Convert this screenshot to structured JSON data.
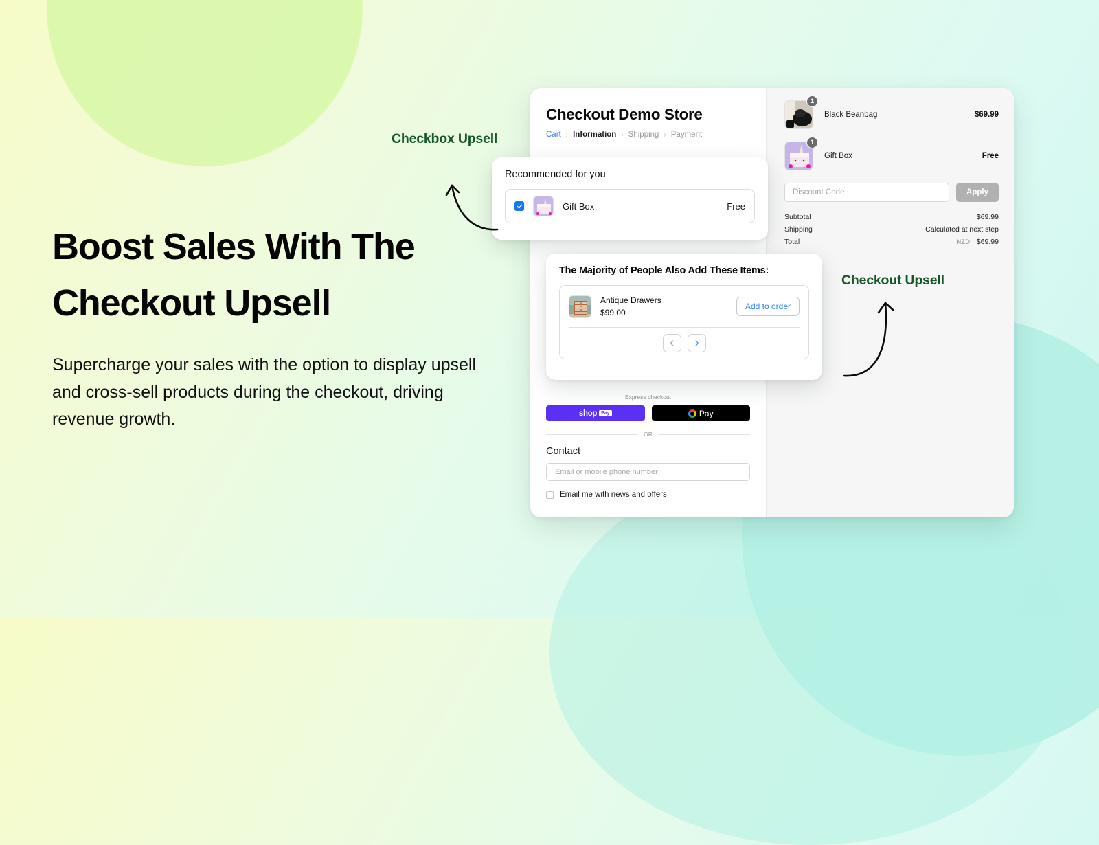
{
  "hero": {
    "headline_line1": "Boost Sales With The",
    "headline_line2": "Checkout Upsell",
    "subtext": "Supercharge your sales with the option to display upsell and cross-sell products during the checkout, driving revenue growth."
  },
  "annotations": {
    "checkbox_upsell": "Checkbox Upsell",
    "checkout_upsell": "Checkout Upsell",
    "color": "#14572a"
  },
  "checkout": {
    "store_title": "Checkout Demo Store",
    "breadcrumb": [
      {
        "label": "Cart",
        "state": "link"
      },
      {
        "label": "Information",
        "state": "current"
      },
      {
        "label": "Shipping",
        "state": "dim"
      },
      {
        "label": "Payment",
        "state": "dim"
      }
    ],
    "breadcrumb_separator": "›",
    "express": {
      "label": "Express checkout",
      "shop_pay_word": "shop",
      "shop_pay_chip": "Pay",
      "google_pay_label": "Pay",
      "or_label": "OR"
    },
    "contact": {
      "heading": "Contact",
      "email_placeholder": "Email or mobile phone number",
      "newsletter_label": "Email me with news and offers"
    }
  },
  "summary": {
    "items": [
      {
        "name": "Black Beanbag",
        "price": "$69.99",
        "qty": "1"
      },
      {
        "name": "Gift Box",
        "price": "Free",
        "qty": "1"
      }
    ],
    "discount_placeholder": "Discount Code",
    "apply_label": "Apply",
    "totals": [
      {
        "label": "Subtotal",
        "value": "$69.99",
        "currency": ""
      },
      {
        "label": "Shipping",
        "value": "Calculated at next step",
        "currency": ""
      },
      {
        "label": "Total",
        "value": "$69.99",
        "currency": "NZD"
      }
    ]
  },
  "checkbox_card": {
    "title": "Recommended for you",
    "item_name": "Gift Box",
    "item_price": "Free",
    "checked": true
  },
  "upsell_card": {
    "title": "The Majority of People Also Add These Items:",
    "item_name": "Antique Drawers",
    "item_price": "$99.00",
    "add_label": "Add to order",
    "prev_icon": "chevron-left",
    "next_icon": "chevron-right"
  },
  "colors": {
    "accent_blue": "#1677f0",
    "shop_pay_purple": "#5a31f4",
    "annotation_green": "#14572a",
    "panel_gray": "#f6f6f6"
  }
}
